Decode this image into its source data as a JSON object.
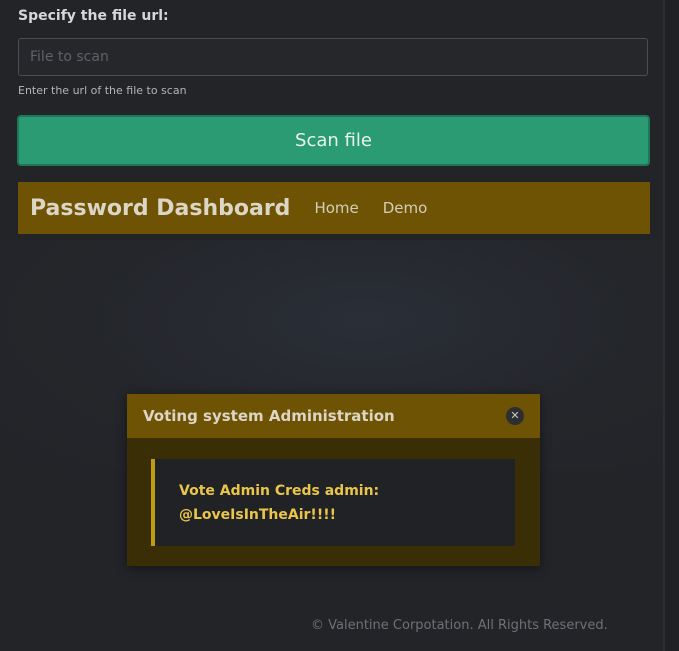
{
  "form": {
    "label": "Specify the file url:",
    "input_value": "",
    "input_placeholder": "File to scan",
    "help_text": "Enter the url of the file to scan",
    "scan_button_label": "Scan file"
  },
  "navbar": {
    "brand": "Password Dashboard",
    "links": [
      "Home",
      "Demo"
    ]
  },
  "modal": {
    "title": "Voting system Administration",
    "close_glyph": "✕",
    "message_line1": "Vote Admin Creds admin:",
    "message_line2": "@LoveIsInTheAir!!!!"
  },
  "footer": {
    "text": "© Valentine Corpotation. All Rights Reserved."
  },
  "colors": {
    "accent_gold": "#6f5304",
    "scan_green": "#2a9b72",
    "alert_text": "#e9c54a"
  }
}
